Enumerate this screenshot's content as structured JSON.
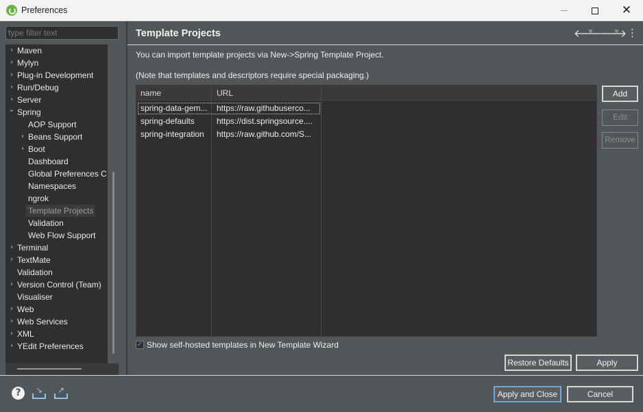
{
  "window": {
    "title": "Preferences"
  },
  "filter": {
    "placeholder": "type filter text"
  },
  "tree": {
    "items": [
      {
        "label": "Maven",
        "expandable": true,
        "expanded": false,
        "level": 0
      },
      {
        "label": "Mylyn",
        "expandable": true,
        "expanded": false,
        "level": 0
      },
      {
        "label": "Plug-in Development",
        "expandable": true,
        "expanded": false,
        "level": 0
      },
      {
        "label": "Run/Debug",
        "expandable": true,
        "expanded": false,
        "level": 0
      },
      {
        "label": "Server",
        "expandable": true,
        "expanded": false,
        "level": 0
      },
      {
        "label": "Spring",
        "expandable": true,
        "expanded": true,
        "level": 0
      },
      {
        "label": "AOP Support",
        "expandable": false,
        "level": 1
      },
      {
        "label": "Beans Support",
        "expandable": true,
        "expanded": false,
        "level": 1
      },
      {
        "label": "Boot",
        "expandable": true,
        "expanded": false,
        "level": 1
      },
      {
        "label": "Dashboard",
        "expandable": false,
        "level": 1
      },
      {
        "label": "Global Preferences C",
        "expandable": false,
        "level": 1
      },
      {
        "label": "Namespaces",
        "expandable": false,
        "level": 1
      },
      {
        "label": "ngrok",
        "expandable": false,
        "level": 1
      },
      {
        "label": "Template Projects",
        "expandable": false,
        "level": 1,
        "selected": true
      },
      {
        "label": "Validation",
        "expandable": false,
        "level": 1
      },
      {
        "label": "Web Flow Support",
        "expandable": false,
        "level": 1
      },
      {
        "label": "Terminal",
        "expandable": true,
        "expanded": false,
        "level": 0
      },
      {
        "label": "TextMate",
        "expandable": true,
        "expanded": false,
        "level": 0
      },
      {
        "label": "Validation",
        "expandable": false,
        "level": 0
      },
      {
        "label": "Version Control (Team)",
        "expandable": true,
        "expanded": false,
        "level": 0
      },
      {
        "label": "Visualiser",
        "expandable": false,
        "level": 0
      },
      {
        "label": "Web",
        "expandable": true,
        "expanded": false,
        "level": 0
      },
      {
        "label": "Web Services",
        "expandable": true,
        "expanded": false,
        "level": 0
      },
      {
        "label": "XML",
        "expandable": true,
        "expanded": false,
        "level": 0
      },
      {
        "label": "YEdit Preferences",
        "expandable": true,
        "expanded": false,
        "level": 0
      }
    ]
  },
  "page": {
    "title": "Template Projects",
    "info_line1": "You can import template projects via New->Spring Template Project.",
    "info_line2": "(Note that templates and descriptors require special packaging.)"
  },
  "table": {
    "columns": [
      "name",
      "URL"
    ],
    "rows": [
      {
        "name": "spring-data-gem...",
        "url": "https://raw.githubuserco..."
      },
      {
        "name": "spring-defaults",
        "url": "https://dist.springsource...."
      },
      {
        "name": "spring-integration",
        "url": "https://raw.github.com/S..."
      }
    ]
  },
  "side_buttons": {
    "add": "Add",
    "edit": "Edit",
    "remove": "Remove"
  },
  "checkbox": {
    "label": "Show self-hosted templates in New Template Wizard",
    "checked": true
  },
  "page_buttons": {
    "restore_defaults": "Restore Defaults",
    "apply": "Apply"
  },
  "footer": {
    "apply_and_close": "Apply and Close",
    "cancel": "Cancel"
  },
  "icons": {
    "help": "help-icon",
    "import": "import-icon",
    "export": "export-icon",
    "back": "back-arrow-icon",
    "forward": "forward-arrow-icon",
    "menu": "view-menu-icon"
  },
  "colors": {
    "background": "#515658",
    "tree_background": "#2f2f2f",
    "accent_blue": "#6fa8dc",
    "spring_green": "#6db33f"
  }
}
